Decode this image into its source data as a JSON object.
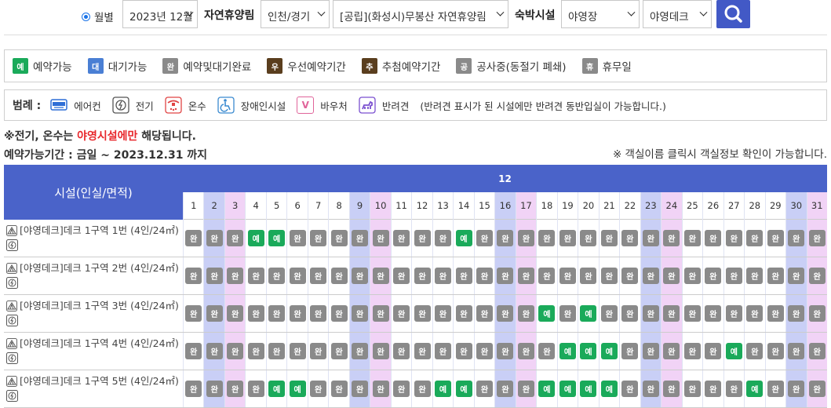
{
  "search": {
    "radio_label": "월별",
    "month": "2023년 12월",
    "forest_label": "자연휴양림",
    "region": "인천/경기",
    "forest": "[공립](화성시)무봉산 자연휴양림",
    "lodging_label": "숙박시설",
    "type1": "야영장",
    "type2": "야영데크"
  },
  "colors": {
    "green": "#1aaa5a",
    "blue": "#4a6fcf",
    "gray": "#8a8a8a",
    "brown": "#5a3e1e",
    "header": "#4a63c9",
    "sat_col": "#c9cff6",
    "sun_col": "#f1d3f6",
    "red": "#e8272c"
  },
  "legend": [
    {
      "badge": "예",
      "label": "예약가능",
      "color": "#1aaa5a"
    },
    {
      "badge": "대",
      "label": "대기가능",
      "color": "#4a7fd4"
    },
    {
      "badge": "완",
      "label": "예약및대기완료",
      "color": "#8a8a8a"
    },
    {
      "badge": "우",
      "label": "우선예약기간",
      "color": "#5a3e1e"
    },
    {
      "badge": "추",
      "label": "추첨예약기간",
      "color": "#5a3e1e"
    },
    {
      "badge": "공",
      "label": "공사중(동절기 폐쇄)",
      "color": "#8a8a8a"
    },
    {
      "badge": "휴",
      "label": "휴무일",
      "color": "#8a8a8a"
    }
  ],
  "icon_legend": {
    "title": "범례 :",
    "items": [
      {
        "icon": "air-conditioner-icon",
        "label": "에어컨"
      },
      {
        "icon": "electricity-icon",
        "label": "전기"
      },
      {
        "icon": "hot-water-icon",
        "label": "온수"
      },
      {
        "icon": "accessibility-icon",
        "label": "장애인시설"
      },
      {
        "icon": "voucher-icon",
        "label": "바우처",
        "glyph": "V"
      },
      {
        "icon": "pet-icon",
        "label": "반려견"
      }
    ],
    "note": "(반려견 표시가 된 시설에만 반려견 동반입실이 가능합니다.)"
  },
  "notice": {
    "part1": "※전기, 온수는 ",
    "highlight": "야영시설에만",
    "part2": " 해당됩니다.",
    "period": "예약가능기간 : 금일 ~ 2023.12.31 까지",
    "click_hint": "※ 객실이름 클릭시 객실정보 확인이 가능합니다."
  },
  "table": {
    "facility_header": "시설(인실/면적)",
    "month": "12",
    "days": [
      "1",
      "2",
      "3",
      "4",
      "5",
      "6",
      "7",
      "8",
      "9",
      "10",
      "11",
      "12",
      "13",
      "14",
      "15",
      "16",
      "17",
      "18",
      "19",
      "20",
      "21",
      "22",
      "23",
      "24",
      "25",
      "26",
      "27",
      "28",
      "29",
      "30",
      "31"
    ],
    "saturdays": [
      2,
      9,
      16,
      23,
      30
    ],
    "sundays": [
      3,
      10,
      17,
      24,
      31
    ],
    "rows": [
      {
        "name": "[야영데크]데크 1구역 1번 (4인/24㎡)",
        "status": [
          "완",
          "완",
          "완",
          "예",
          "예",
          "완",
          "완",
          "완",
          "완",
          "완",
          "완",
          "완",
          "완",
          "예",
          "완",
          "완",
          "완",
          "완",
          "완",
          "완",
          "완",
          "완",
          "완",
          "완",
          "완",
          "완",
          "완",
          "완",
          "완",
          "완",
          "완"
        ]
      },
      {
        "name": "[야영데크]데크 1구역 2번 (4인/24㎡)",
        "status": [
          "완",
          "완",
          "완",
          "완",
          "완",
          "완",
          "완",
          "완",
          "완",
          "완",
          "완",
          "완",
          "완",
          "완",
          "완",
          "완",
          "완",
          "완",
          "완",
          "완",
          "완",
          "완",
          "완",
          "완",
          "완",
          "완",
          "완",
          "완",
          "완",
          "완",
          "완"
        ]
      },
      {
        "name": "[야영데크]데크 1구역 3번 (4인/24㎡)",
        "status": [
          "완",
          "완",
          "완",
          "완",
          "완",
          "완",
          "완",
          "완",
          "완",
          "완",
          "완",
          "완",
          "완",
          "완",
          "완",
          "완",
          "완",
          "예",
          "완",
          "예",
          "완",
          "완",
          "완",
          "완",
          "완",
          "완",
          "완",
          "완",
          "완",
          "완",
          "완"
        ]
      },
      {
        "name": "[야영데크]데크 1구역 4번 (4인/24㎡)",
        "status": [
          "완",
          "완",
          "완",
          "완",
          "완",
          "완",
          "완",
          "완",
          "완",
          "완",
          "완",
          "완",
          "완",
          "완",
          "완",
          "완",
          "완",
          "완",
          "예",
          "예",
          "예",
          "완",
          "완",
          "완",
          "완",
          "완",
          "예",
          "완",
          "완",
          "완",
          "완"
        ]
      },
      {
        "name": "[야영데크]데크 1구역 5번 (4인/24㎡)",
        "status": [
          "완",
          "완",
          "완",
          "완",
          "예",
          "예",
          "완",
          "완",
          "완",
          "완",
          "완",
          "완",
          "예",
          "예",
          "완",
          "완",
          "완",
          "예",
          "예",
          "예",
          "예",
          "완",
          "완",
          "완",
          "완",
          "완",
          "완",
          "예",
          "완",
          "완",
          "완"
        ]
      }
    ]
  }
}
